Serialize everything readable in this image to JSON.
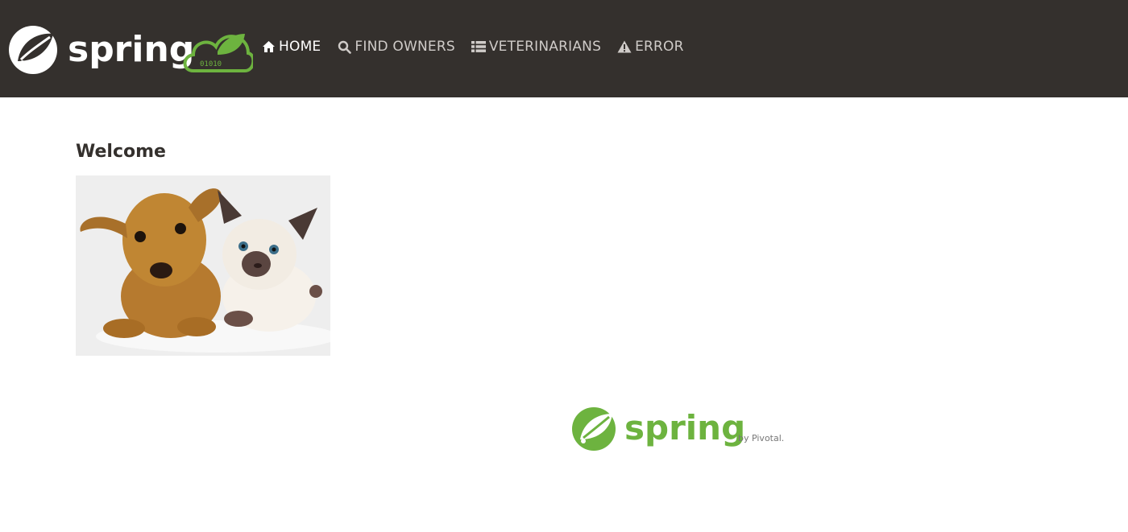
{
  "header": {
    "brand_wordmark": "spring",
    "brand_badge_digits": "01010",
    "nav": [
      {
        "label": "HOME",
        "icon": "home-icon",
        "active": true
      },
      {
        "label": "FIND OWNERS",
        "icon": "search-icon",
        "active": false
      },
      {
        "label": "VETERINARIANS",
        "icon": "list-icon",
        "active": false
      },
      {
        "label": "ERROR",
        "icon": "warning-icon",
        "active": false
      }
    ]
  },
  "main": {
    "title": "Welcome",
    "image_name": "pets-image"
  },
  "footer": {
    "wordmark": "spring",
    "tagline": "by Pivotal."
  },
  "colors": {
    "navbar_bg": "#34302d",
    "brand_green": "#6db33f",
    "nav_text": "#cfcbc8",
    "nav_active": "#ffffff"
  }
}
